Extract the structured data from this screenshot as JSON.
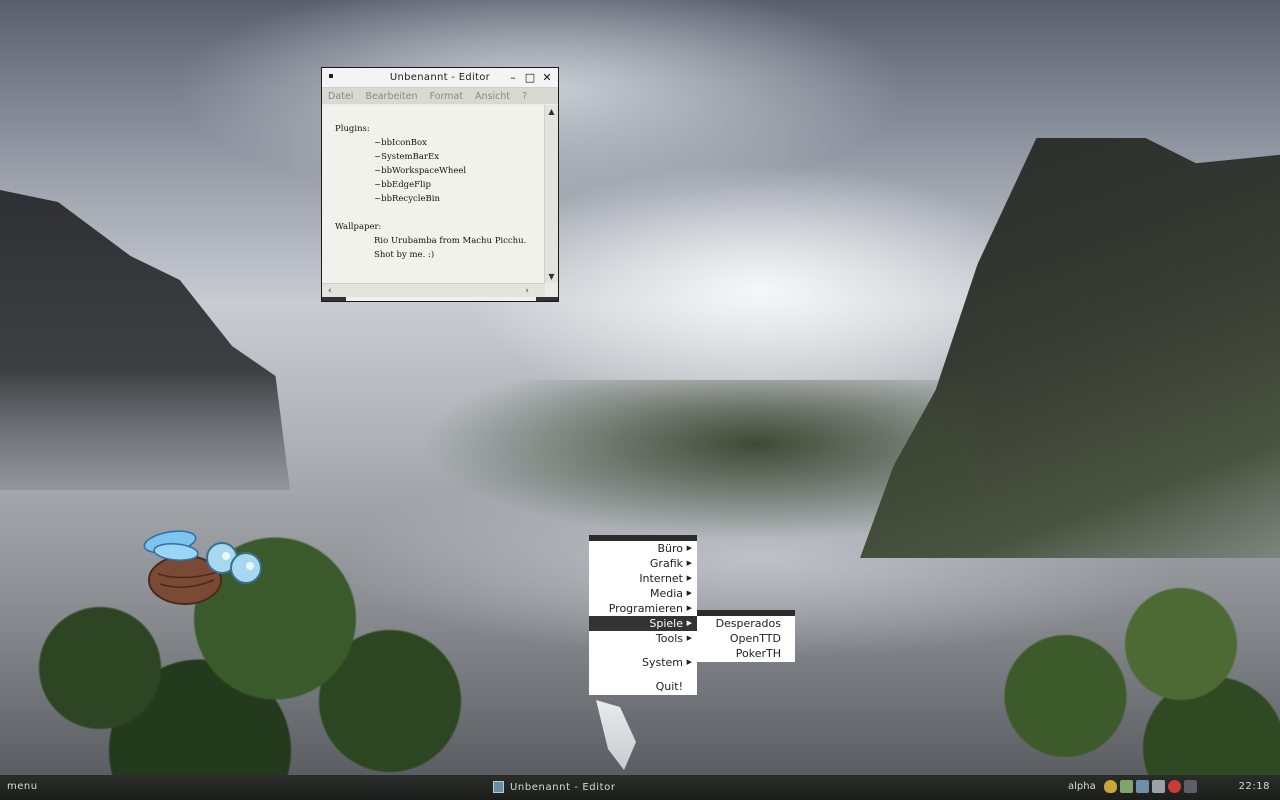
{
  "editor": {
    "title": "Unbenannt - Editor",
    "menu": [
      "Datei",
      "Bearbeiten",
      "Format",
      "Ansicht",
      "?"
    ],
    "lines": [
      {
        "text": "Plugins:",
        "indent": false
      },
      {
        "text": "~bbIconBox",
        "indent": true
      },
      {
        "text": "~SystemBarEx",
        "indent": true
      },
      {
        "text": "~bbWorkspaceWheel",
        "indent": true
      },
      {
        "text": "~bbEdgeFlip",
        "indent": true
      },
      {
        "text": "~bbRecycleBin",
        "indent": true
      },
      {
        "text": "",
        "indent": false
      },
      {
        "text": "Wallpaper:",
        "indent": false
      },
      {
        "text": "Rio Urubamba from Machu Picchu.",
        "indent": true
      },
      {
        "text": "Shot by me. :)",
        "indent": true
      }
    ]
  },
  "rootmenu": {
    "items": [
      {
        "label": "Büro",
        "submenu": true
      },
      {
        "label": "Grafik",
        "submenu": true
      },
      {
        "label": "Internet",
        "submenu": true
      },
      {
        "label": "Media",
        "submenu": true
      },
      {
        "label": "Programieren",
        "submenu": true
      },
      {
        "label": "Spiele",
        "submenu": true,
        "active": true
      },
      {
        "label": "Tools",
        "submenu": true
      }
    ],
    "system": {
      "label": "System",
      "submenu": true
    },
    "quit": {
      "label": "Quit!"
    }
  },
  "submenu": {
    "items": [
      "Desperados",
      "OpenTTD",
      "PokerTH"
    ]
  },
  "taskbar": {
    "menu_label": "menu",
    "task_title": "Unbenannt - Editor",
    "workspace": "alpha",
    "clock": "22:18",
    "tray_icons": [
      "shield-icon",
      "network-icon",
      "display-icon",
      "volume-icon",
      "antivirus-icon",
      "tray-misc-icon"
    ]
  }
}
